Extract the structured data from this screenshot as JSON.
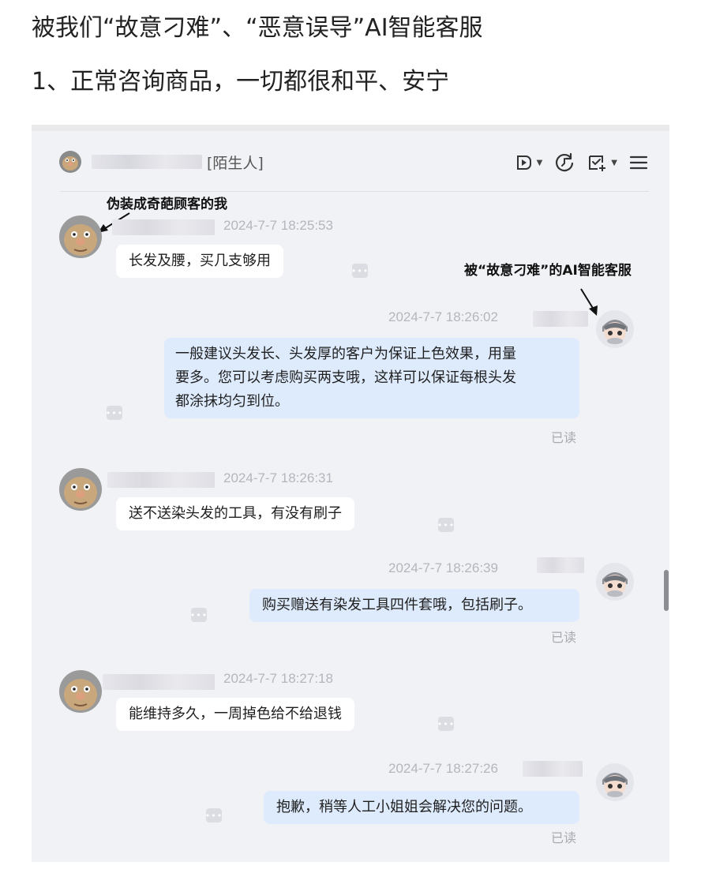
{
  "article": {
    "title": "被我们“故意刁难”、“恶意误导”AI智能客服",
    "subtitle": "1、正常咨询商品，一切都很和平、安宁"
  },
  "chat": {
    "header": {
      "contact_tag": "[陌生人]"
    },
    "annotations": {
      "customer": "伪装成奇葩顾客的我",
      "bot": "被“故意刁难”的AI智能客服"
    },
    "messages": [
      {
        "sender": "customer",
        "time": "2024-7-7 18:25:53",
        "text": "长发及腰，买几支够用"
      },
      {
        "sender": "bot",
        "time": "2024-7-7 18:26:02",
        "lines": [
          "一般建议头发长、头发厚的客户为保证上色效果，用量",
          "要多。您可以考虑购买两支哦，这样可以保证每根头发",
          "都涂抹均匀到位。"
        ],
        "status": "已读"
      },
      {
        "sender": "customer",
        "time": "2024-7-7 18:26:31",
        "text": "送不送染头发的工具，有没有刷子"
      },
      {
        "sender": "bot",
        "time": "2024-7-7 18:26:39",
        "text": "购买赠送有染发工具四件套哦，包括刷子。",
        "status": "已读"
      },
      {
        "sender": "customer",
        "time": "2024-7-7 18:27:18",
        "text": "能维持多久，一周掉色给不给退钱"
      },
      {
        "sender": "bot",
        "time": "2024-7-7 18:27:26",
        "text": "抱歉，稍等人工小姐姐会解决您的问题。",
        "status": "已读"
      }
    ],
    "more_glyph": "•••"
  },
  "icons": {
    "header": [
      "video-call-icon",
      "history-icon",
      "task-check-icon",
      "menu-icon"
    ],
    "avatars": [
      "customer-avatar",
      "bot-avatar"
    ]
  },
  "colors": {
    "customer_bubble": "#ffffff",
    "bot_bubble": "#deebfd",
    "chat_bg": "#f1f2f6"
  }
}
